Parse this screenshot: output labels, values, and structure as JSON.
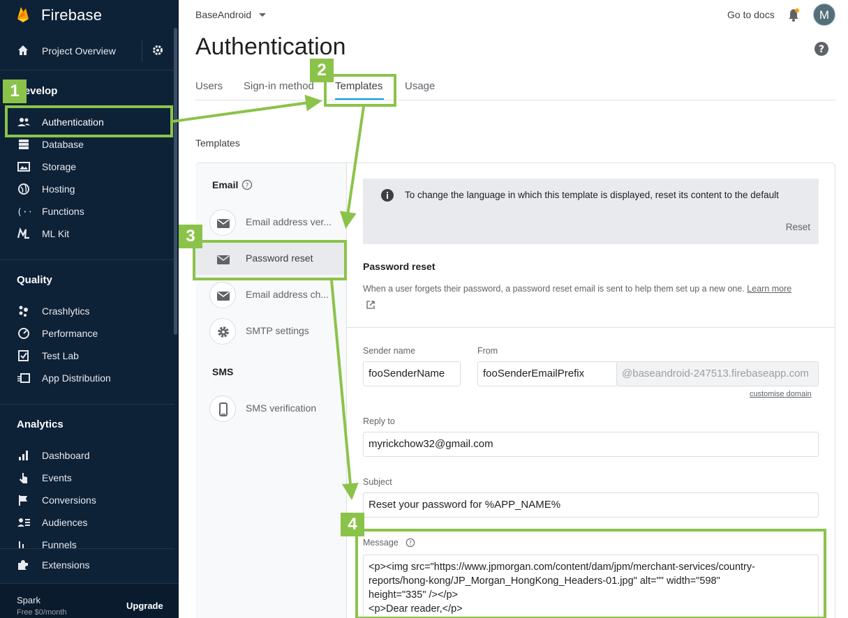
{
  "sidebar": {
    "brand": "Firebase",
    "overview": "Project Overview",
    "sections": {
      "develop": "Develop",
      "quality": "Quality",
      "analytics": "Analytics"
    },
    "develop_items": [
      {
        "label": "Authentication",
        "icon": "people-icon"
      },
      {
        "label": "Database",
        "icon": "database-icon"
      },
      {
        "label": "Storage",
        "icon": "image-icon"
      },
      {
        "label": "Hosting",
        "icon": "globe-icon"
      },
      {
        "label": "Functions",
        "icon": "functions-icon"
      },
      {
        "label": "ML Kit",
        "icon": "ml-kit-icon"
      }
    ],
    "quality_items": [
      {
        "label": "Crashlytics",
        "icon": "crashlytics-icon"
      },
      {
        "label": "Performance",
        "icon": "speed-icon"
      },
      {
        "label": "Test Lab",
        "icon": "checklist-icon"
      },
      {
        "label": "App Distribution",
        "icon": "distribution-icon"
      }
    ],
    "analytics_items": [
      {
        "label": "Dashboard",
        "icon": "bar-chart-icon"
      },
      {
        "label": "Events",
        "icon": "touch-icon"
      },
      {
        "label": "Conversions",
        "icon": "flag-icon"
      },
      {
        "label": "Audiences",
        "icon": "audience-icon"
      },
      {
        "label": "Funnels",
        "icon": "funnel-icon"
      }
    ],
    "extensions": "Extensions",
    "plan": "Spark",
    "price": "Free $0/month",
    "upgrade": "Upgrade"
  },
  "topbar": {
    "project": "BaseAndroid",
    "docs": "Go to docs",
    "avatar_initial": "M"
  },
  "page": {
    "title": "Authentication",
    "tabs": [
      "Users",
      "Sign-in method",
      "Templates",
      "Usage"
    ],
    "active_tab": "Templates",
    "section_label": "Templates"
  },
  "templates": {
    "email_group": "Email",
    "sms_group": "SMS",
    "email_items": [
      {
        "label": "Email address ver...",
        "icon": "mail-icon"
      },
      {
        "label": "Password reset",
        "icon": "mail-icon"
      },
      {
        "label": "Email address ch...",
        "icon": "mail-icon"
      },
      {
        "label": "SMTP settings",
        "icon": "gear-icon"
      }
    ],
    "sms_items": [
      {
        "label": "SMS verification",
        "icon": "phone-icon"
      }
    ]
  },
  "editor": {
    "notice": "To change the language in which this template is displayed, reset its content to the default",
    "notice_reset": "Reset",
    "title": "Password reset",
    "description": "When a user forgets their password, a password reset email is sent to help them set up a new one.",
    "learn_more": "Learn more",
    "sender_label": "Sender name",
    "sender_value": "fooSenderName",
    "from_label": "From",
    "from_value": "fooSenderEmailPrefix",
    "from_suffix": "@baseandroid-247513.firebaseapp.com",
    "customise_domain": "customise domain",
    "reply_label": "Reply to",
    "reply_value": "myrickchow32@gmail.com",
    "subject_label": "Subject",
    "subject_value": "Reset your password for %APP_NAME%",
    "message_label": "Message",
    "message_lines": [
      "<p><img src=\"https://www.jpmorgan.com/content/dam/jpm/merchant-services/country-",
      "reports/hong-kong/JP_Morgan_HongKong_Headers-01.jpg\" alt=\"\" width=\"598\"",
      "height=\"335\" /></p>",
      "<p>Dear reader,</p>"
    ]
  },
  "annotations": {
    "badges": [
      "1",
      "2",
      "3",
      "4"
    ],
    "color": "#8bc34a"
  },
  "colors": {
    "sidebar_bg": "#0d2137",
    "accent": "#039be5",
    "annotation": "#8bc34a"
  }
}
